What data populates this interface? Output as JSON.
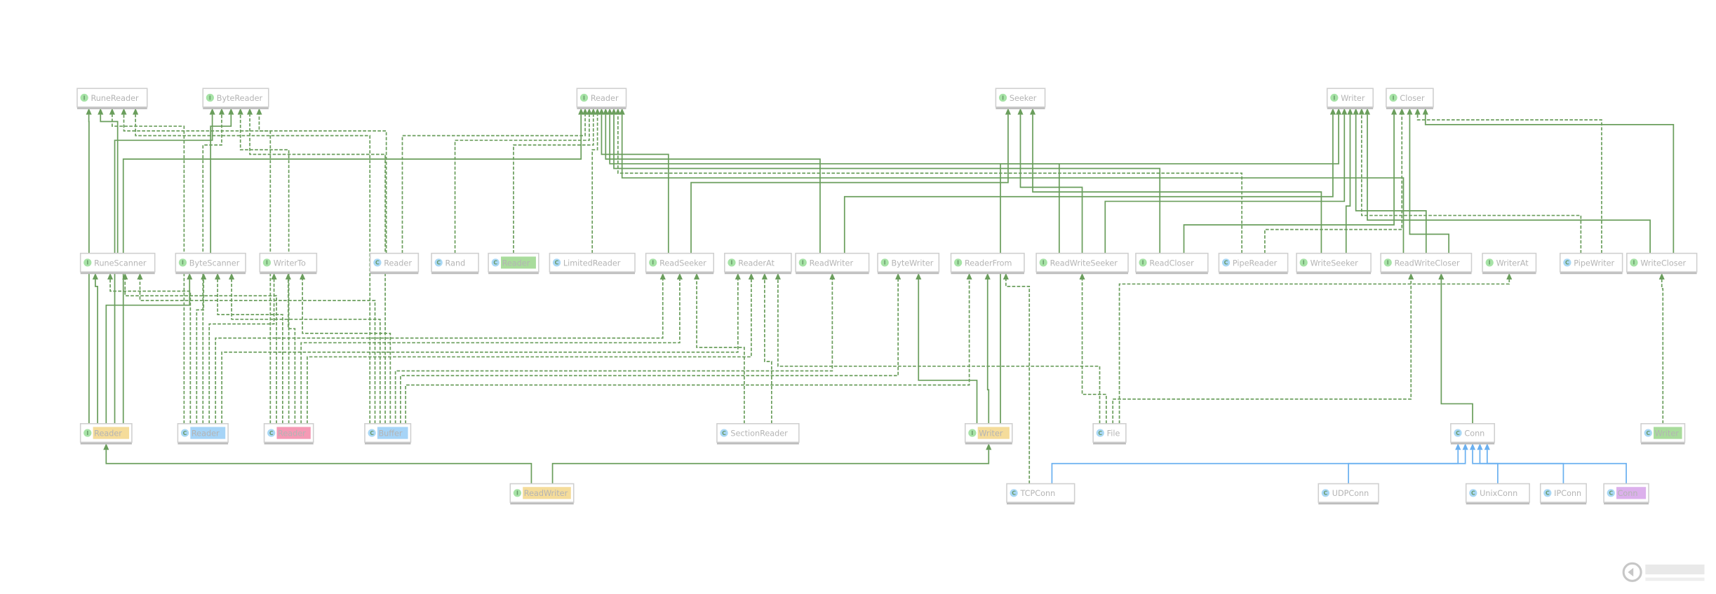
{
  "colors": {
    "edge_green": "#6a9e5c",
    "edge_blue": "#6ab0f0",
    "interface_icon": "#a6e3a6",
    "class_icon": "#a9d8f5",
    "highlight_yellow": "#f5dc9a",
    "highlight_blue": "#a6d4f7",
    "highlight_pink": "#f59ab5",
    "highlight_green": "#a9dc9c",
    "highlight_purple": "#dcb0ec"
  },
  "nodes": [
    {
      "id": "RuneReader",
      "label": "RuneReader",
      "kind": "I"
    },
    {
      "id": "ByteReader",
      "label": "ByteReader",
      "kind": "I"
    },
    {
      "id": "IReader",
      "label": "Reader",
      "kind": "I"
    },
    {
      "id": "Seeker",
      "label": "Seeker",
      "kind": "I"
    },
    {
      "id": "Writer",
      "label": "Writer",
      "kind": "I"
    },
    {
      "id": "Closer",
      "label": "Closer",
      "kind": "I"
    },
    {
      "id": "RuneScanner",
      "label": "RuneScanner",
      "kind": "I"
    },
    {
      "id": "ByteScanner",
      "label": "ByteScanner",
      "kind": "I"
    },
    {
      "id": "WriterTo",
      "label": "WriterTo",
      "kind": "I"
    },
    {
      "id": "CReaderMid",
      "label": "Reader",
      "kind": "C"
    },
    {
      "id": "Rand",
      "label": "Rand",
      "kind": "C"
    },
    {
      "id": "CReaderGreen",
      "label": "Reader",
      "kind": "C",
      "highlight": "green"
    },
    {
      "id": "LimitedReader",
      "label": "LimitedReader",
      "kind": "C"
    },
    {
      "id": "ReadSeeker",
      "label": "ReadSeeker",
      "kind": "I"
    },
    {
      "id": "ReaderAt",
      "label": "ReaderAt",
      "kind": "I"
    },
    {
      "id": "ReadWriter",
      "label": "ReadWriter",
      "kind": "I"
    },
    {
      "id": "ByteWriter",
      "label": "ByteWriter",
      "kind": "I"
    },
    {
      "id": "ReaderFrom",
      "label": "ReaderFrom",
      "kind": "I"
    },
    {
      "id": "ReadWriteSeeker",
      "label": "ReadWriteSeeker",
      "kind": "I"
    },
    {
      "id": "ReadCloser",
      "label": "ReadCloser",
      "kind": "I"
    },
    {
      "id": "PipeReader",
      "label": "PipeReader",
      "kind": "C"
    },
    {
      "id": "WriteSeeker",
      "label": "WriteSeeker",
      "kind": "I"
    },
    {
      "id": "ReadWriteCloser",
      "label": "ReadWriteCloser",
      "kind": "I"
    },
    {
      "id": "WriterAt",
      "label": "WriterAt",
      "kind": "I"
    },
    {
      "id": "PipeWriter",
      "label": "PipeWriter",
      "kind": "C"
    },
    {
      "id": "WriteCloser",
      "label": "WriteCloser",
      "kind": "I"
    },
    {
      "id": "IReaderYellow",
      "label": "Reader",
      "kind": "I",
      "highlight": "yellow"
    },
    {
      "id": "CReaderBlue",
      "label": "Reader",
      "kind": "C",
      "highlight": "blue"
    },
    {
      "id": "CReaderPink",
      "label": "Reader",
      "kind": "C",
      "highlight": "pink"
    },
    {
      "id": "Buffer",
      "label": "Buffer",
      "kind": "C",
      "highlight": "blue"
    },
    {
      "id": "SectionReader",
      "label": "SectionReader",
      "kind": "C"
    },
    {
      "id": "IWriterYellow",
      "label": "Writer",
      "kind": "I",
      "highlight": "yellow"
    },
    {
      "id": "File",
      "label": "File",
      "kind": "C"
    },
    {
      "id": "Conn",
      "label": "Conn",
      "kind": "C"
    },
    {
      "id": "CWriterGreen",
      "label": "Writer",
      "kind": "C",
      "highlight": "green"
    },
    {
      "id": "IReadWriterYellow",
      "label": "ReadWriter",
      "kind": "I",
      "highlight": "yellow"
    },
    {
      "id": "TCPConn",
      "label": "TCPConn",
      "kind": "C"
    },
    {
      "id": "UDPConn",
      "label": "UDPConn",
      "kind": "C"
    },
    {
      "id": "UnixConn",
      "label": "UnixConn",
      "kind": "C"
    },
    {
      "id": "IPConn",
      "label": "IPConn",
      "kind": "C"
    },
    {
      "id": "CConnPurple",
      "label": "Conn",
      "kind": "C",
      "highlight": "purple"
    }
  ],
  "edges": [
    {
      "from": "IReaderYellow",
      "to": "RuneReader",
      "style": "solid"
    },
    {
      "from": "RuneScanner",
      "to": "RuneReader",
      "style": "solid"
    },
    {
      "from": "CReaderBlue",
      "to": "RuneReader",
      "style": "dashed"
    },
    {
      "from": "CReaderPink",
      "to": "RuneReader",
      "style": "dashed"
    },
    {
      "from": "Buffer",
      "to": "RuneReader",
      "style": "dashed"
    },
    {
      "from": "IReaderYellow",
      "to": "ByteReader",
      "style": "solid"
    },
    {
      "from": "ByteScanner",
      "to": "ByteReader",
      "style": "solid"
    },
    {
      "from": "CReaderBlue",
      "to": "ByteReader",
      "style": "dashed"
    },
    {
      "from": "CReaderPink",
      "to": "ByteReader",
      "style": "dashed"
    },
    {
      "from": "Buffer",
      "to": "ByteReader",
      "style": "dashed"
    },
    {
      "from": "CReaderMid",
      "to": "ByteReader",
      "style": "dashed"
    },
    {
      "from": "IReaderYellow",
      "to": "RuneScanner",
      "style": "solid"
    },
    {
      "from": "CReaderBlue",
      "to": "RuneScanner",
      "style": "dashed"
    },
    {
      "from": "CReaderPink",
      "to": "RuneScanner",
      "style": "dashed"
    },
    {
      "from": "Buffer",
      "to": "RuneScanner",
      "style": "dashed"
    },
    {
      "from": "IReaderYellow",
      "to": "ByteScanner",
      "style": "solid"
    },
    {
      "from": "CReaderBlue",
      "to": "ByteScanner",
      "style": "dashed"
    },
    {
      "from": "CReaderPink",
      "to": "ByteScanner",
      "style": "dashed"
    },
    {
      "from": "Buffer",
      "to": "ByteScanner",
      "style": "dashed"
    },
    {
      "from": "CReaderBlue",
      "to": "WriterTo",
      "style": "dashed"
    },
    {
      "from": "CReaderPink",
      "to": "WriterTo",
      "style": "dashed"
    },
    {
      "from": "Buffer",
      "to": "WriterTo",
      "style": "dashed"
    },
    {
      "from": "IReaderYellow",
      "to": "IReader",
      "style": "solid"
    },
    {
      "from": "CReaderMid",
      "to": "IReader",
      "style": "dashed"
    },
    {
      "from": "Rand",
      "to": "IReader",
      "style": "dashed"
    },
    {
      "from": "CReaderGreen",
      "to": "IReader",
      "style": "dashed"
    },
    {
      "from": "LimitedReader",
      "to": "IReader",
      "style": "dashed"
    },
    {
      "from": "ReadSeeker",
      "to": "IReader",
      "style": "solid"
    },
    {
      "from": "ReadWriter",
      "to": "IReader",
      "style": "solid"
    },
    {
      "from": "ReadWriteSeeker",
      "to": "IReader",
      "style": "solid"
    },
    {
      "from": "ReadCloser",
      "to": "IReader",
      "style": "solid"
    },
    {
      "from": "PipeReader",
      "to": "IReader",
      "style": "dashed"
    },
    {
      "from": "ReadWriteCloser",
      "to": "IReader",
      "style": "solid"
    },
    {
      "from": "ReadSeeker",
      "to": "Seeker",
      "style": "solid"
    },
    {
      "from": "ReadWriteSeeker",
      "to": "Seeker",
      "style": "solid"
    },
    {
      "from": "WriteSeeker",
      "to": "Seeker",
      "style": "solid"
    },
    {
      "from": "ReadWriter",
      "to": "Writer",
      "style": "solid"
    },
    {
      "from": "ReadWriteSeeker",
      "to": "Writer",
      "style": "solid"
    },
    {
      "from": "WriteSeeker",
      "to": "Writer",
      "style": "solid"
    },
    {
      "from": "ReadWriteCloser",
      "to": "Writer",
      "style": "solid"
    },
    {
      "from": "PipeWriter",
      "to": "Writer",
      "style": "dashed"
    },
    {
      "from": "WriteCloser",
      "to": "Writer",
      "style": "solid"
    },
    {
      "from": "IWriterYellow",
      "to": "Writer",
      "style": "solid"
    },
    {
      "from": "ReadCloser",
      "to": "Closer",
      "style": "solid"
    },
    {
      "from": "PipeReader",
      "to": "Closer",
      "style": "dashed"
    },
    {
      "from": "ReadWriteCloser",
      "to": "Closer",
      "style": "solid"
    },
    {
      "from": "PipeWriter",
      "to": "Closer",
      "style": "dashed"
    },
    {
      "from": "WriteCloser",
      "to": "Closer",
      "style": "solid"
    },
    {
      "from": "CReaderBlue",
      "to": "ReadSeeker",
      "style": "dashed"
    },
    {
      "from": "CReaderPink",
      "to": "ReadSeeker",
      "style": "dashed"
    },
    {
      "from": "SectionReader",
      "to": "ReadSeeker",
      "style": "dashed"
    },
    {
      "from": "CReaderBlue",
      "to": "ReaderAt",
      "style": "dashed"
    },
    {
      "from": "CReaderPink",
      "to": "ReaderAt",
      "style": "dashed"
    },
    {
      "from": "SectionReader",
      "to": "ReaderAt",
      "style": "dashed"
    },
    {
      "from": "File",
      "to": "ReaderAt",
      "style": "dashed"
    },
    {
      "from": "Buffer",
      "to": "ReadWriter",
      "style": "dashed"
    },
    {
      "from": "Buffer",
      "to": "ByteWriter",
      "style": "dashed"
    },
    {
      "from": "IWriterYellow",
      "to": "ByteWriter",
      "style": "solid"
    },
    {
      "from": "Buffer",
      "to": "ReaderFrom",
      "style": "dashed"
    },
    {
      "from": "IWriterYellow",
      "to": "ReaderFrom",
      "style": "solid"
    },
    {
      "from": "TCPConn",
      "to": "ReaderFrom",
      "style": "dashed"
    },
    {
      "from": "File",
      "to": "ReadWriteSeeker",
      "style": "dashed"
    },
    {
      "from": "File",
      "to": "ReadWriteCloser",
      "style": "dashed"
    },
    {
      "from": "Conn",
      "to": "ReadWriteCloser",
      "style": "solid"
    },
    {
      "from": "File",
      "to": "WriterAt",
      "style": "dashed"
    },
    {
      "from": "CWriterGreen",
      "to": "WriteCloser",
      "style": "dashed"
    },
    {
      "from": "IReadWriterYellow",
      "to": "IReaderYellow",
      "style": "solid"
    },
    {
      "from": "IReadWriterYellow",
      "to": "IWriterYellow",
      "style": "solid"
    },
    {
      "from": "TCPConn",
      "to": "Conn",
      "style": "solid",
      "color": "blue"
    },
    {
      "from": "UDPConn",
      "to": "Conn",
      "style": "solid",
      "color": "blue"
    },
    {
      "from": "UnixConn",
      "to": "Conn",
      "style": "solid",
      "color": "blue"
    },
    {
      "from": "IPConn",
      "to": "Conn",
      "style": "solid",
      "color": "blue"
    },
    {
      "from": "CConnPurple",
      "to": "Conn",
      "style": "solid",
      "color": "blue"
    }
  ],
  "watermark": {
    "text": "创新互联"
  }
}
